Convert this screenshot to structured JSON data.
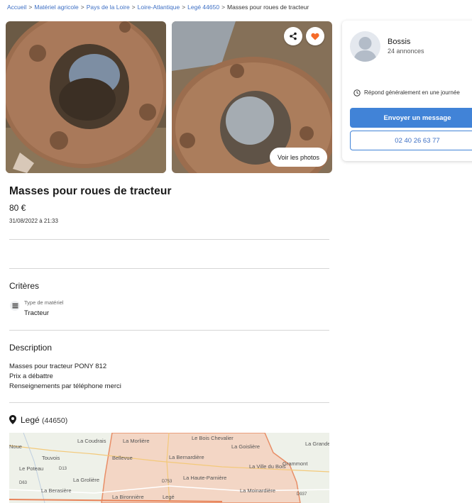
{
  "breadcrumb": {
    "items": [
      "Accueil",
      "Matériel agricole",
      "Pays de la Loire",
      "Loire-Atlantique",
      "Legé 44650"
    ],
    "current": "Masses pour roues de tracteur"
  },
  "gallery": {
    "see_photos_label": "Voir les photos",
    "share_icon": "share-icon",
    "favorite_icon": "heart-icon",
    "favorite_color": "#f56b2a"
  },
  "ad": {
    "title": "Masses pour roues de tracteur",
    "price": "80 €",
    "date": "31/08/2022 à 21:33"
  },
  "criteria": {
    "heading": "Critères",
    "items": [
      {
        "label": "Type de matériel",
        "value": "Tracteur",
        "icon": "equipment-icon"
      }
    ]
  },
  "description": {
    "heading": "Description",
    "lines": [
      "Masses pour tracteur PONY 812",
      "Prix a débattre",
      "Renseignements par téléphone merci"
    ]
  },
  "location": {
    "city": "Legé",
    "zip": "(44650)",
    "icon": "map-pin-icon",
    "map_labels": [
      "Noue",
      "La Coudrais",
      "La Morlière",
      "Le Bois Chevalier",
      "La Goislière",
      "La Grande Métairie",
      "Touvois",
      "Bellevue",
      "La Bernardière",
      "Le Poteau",
      "La Grolière",
      "La Ville du Bois",
      "Grammont",
      "La Haute-Parnière",
      "La Berasière",
      "La Bironnière",
      "Legé",
      "La Moinardière",
      "D753",
      "D937",
      "D63",
      "D13"
    ]
  },
  "seller": {
    "name": "Bossis",
    "count": "24 annonces",
    "reply_time": "Répond généralement en une journée",
    "message_label": "Envoyer un message",
    "phone": "02 40 26 63 77"
  },
  "colors": {
    "accent": "#4183d7",
    "link": "#3d6fc4",
    "favorite": "#f56b2a"
  }
}
